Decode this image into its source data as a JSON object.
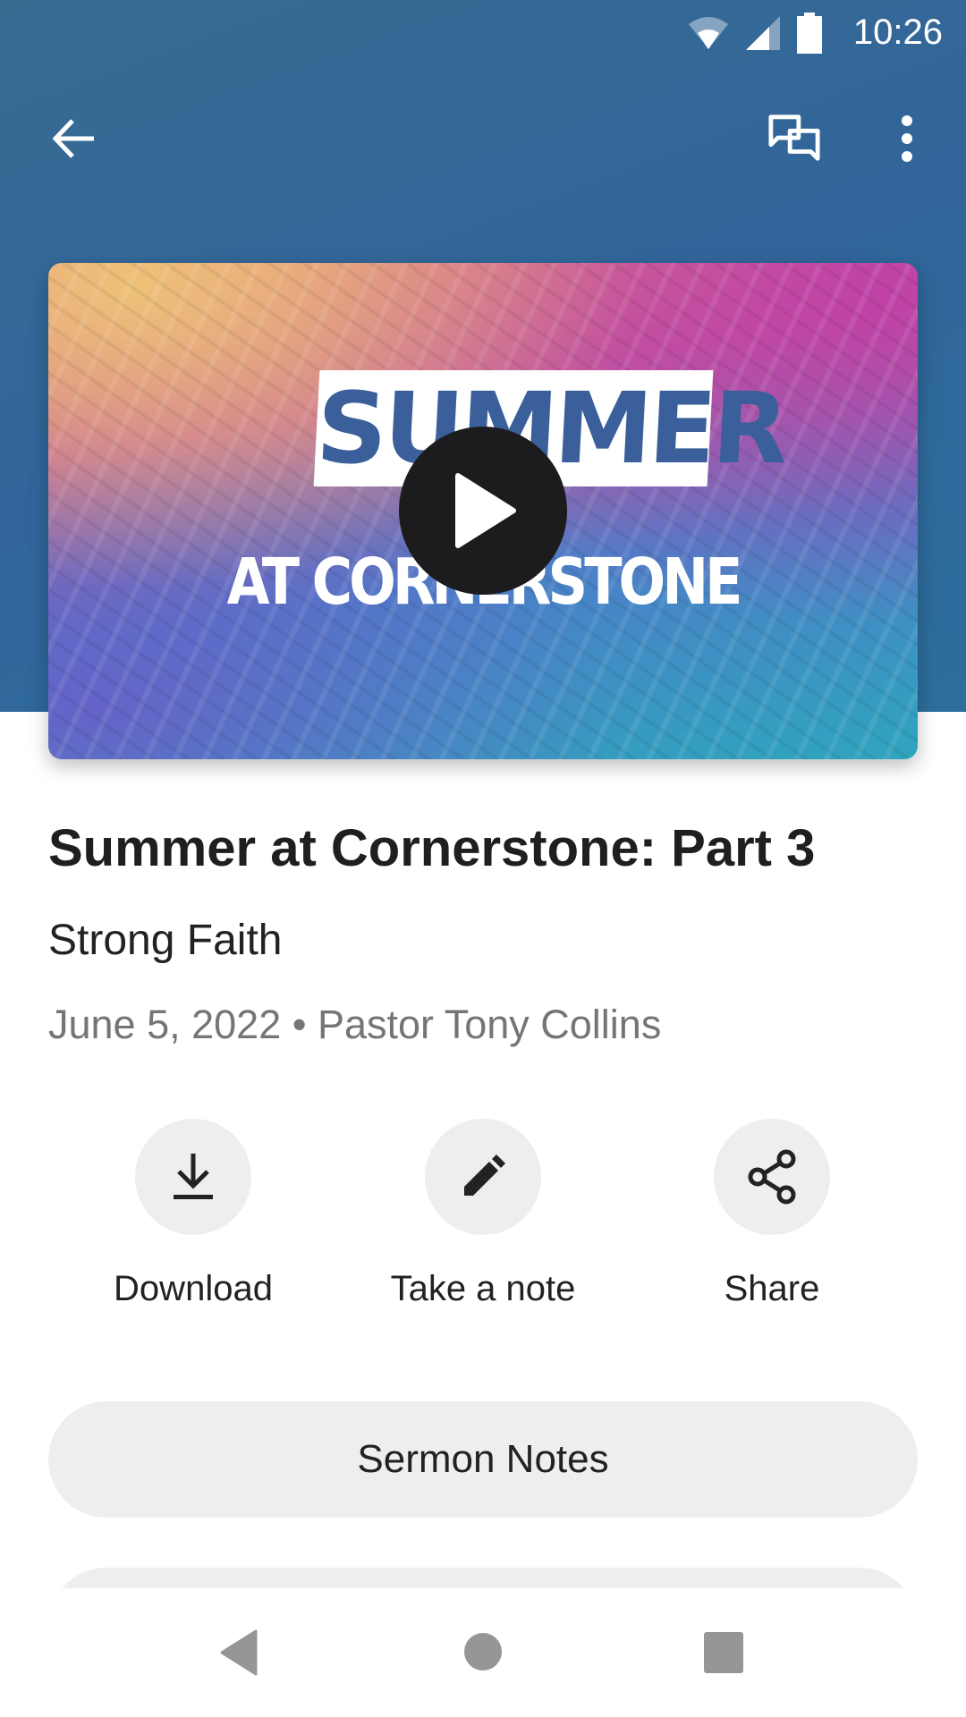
{
  "status_bar": {
    "time": "10:26",
    "icons": [
      "wifi-icon",
      "signal-icon",
      "battery-icon"
    ]
  },
  "toolbar": {
    "back_icon": "arrow-left-icon",
    "chat_icon": "chat-bubbles-icon",
    "more_icon": "more-vertical-icon"
  },
  "media": {
    "art_line1": "SUMMER",
    "art_line2": "AT CORNERSTONE",
    "play_icon": "play-icon"
  },
  "sermon": {
    "title": "Summer at Cornerstone: Part 3",
    "subtitle": "Strong Faith",
    "meta": "June 5, 2022 • Pastor Tony Collins"
  },
  "actions": [
    {
      "label": "Download",
      "icon": "download-icon"
    },
    {
      "label": "Take a note",
      "icon": "pencil-icon"
    },
    {
      "label": "Share",
      "icon": "share-icon"
    }
  ],
  "buttons": {
    "sermon_notes": "Sermon Notes"
  },
  "colors": {
    "header": "#31659a",
    "button_bg": "#eceeef",
    "nav_icon": "#969696"
  },
  "navbar": {
    "icons": [
      "back-triangle-icon",
      "home-circle-icon",
      "recents-square-icon"
    ]
  }
}
